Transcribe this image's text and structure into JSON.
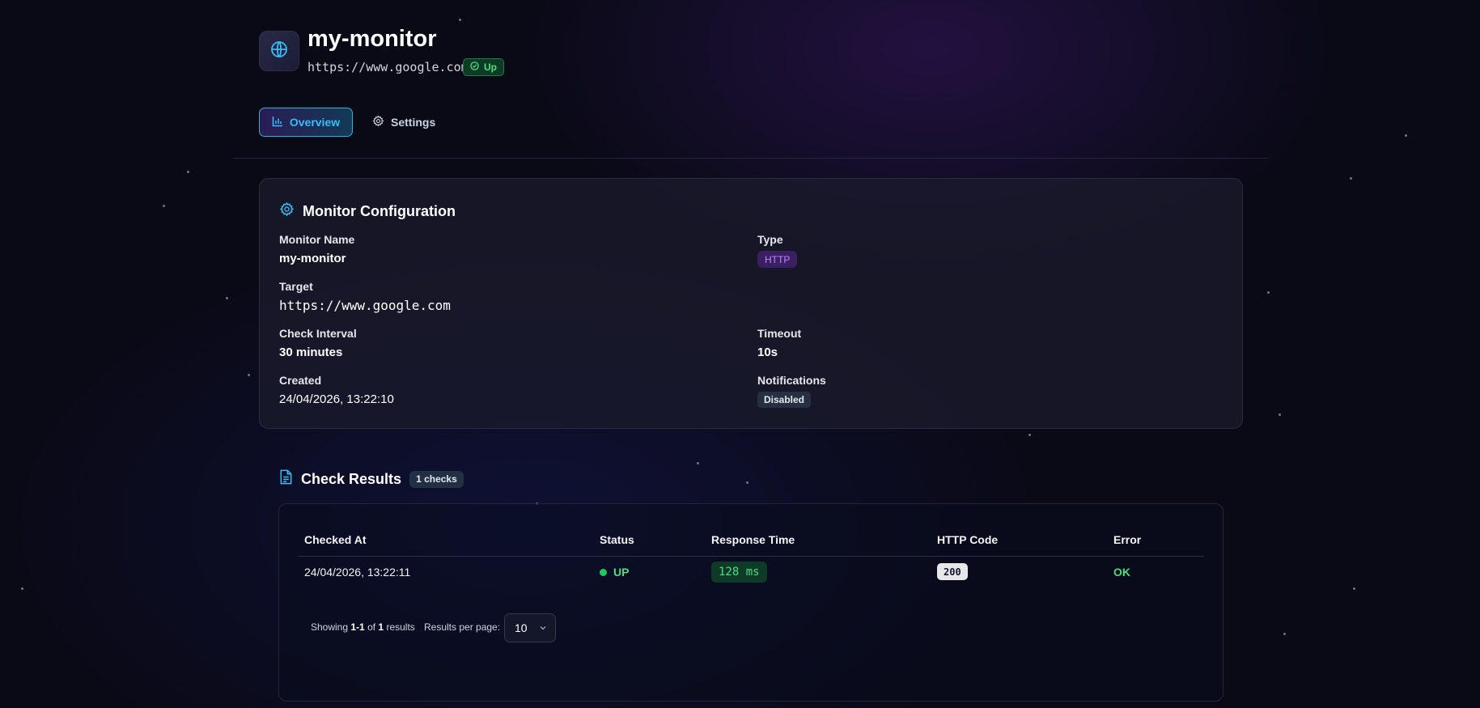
{
  "header": {
    "title": "my-monitor",
    "url": "https://www.google.com",
    "status_badge": "Up",
    "icon": "globe-icon"
  },
  "tabs": [
    {
      "label": "Overview",
      "icon": "bar-chart-icon",
      "active": true
    },
    {
      "label": "Settings",
      "icon": "gear-icon",
      "active": false
    }
  ],
  "config": {
    "title": "Monitor Configuration",
    "name_label": "Monitor Name",
    "name_value": "my-monitor",
    "type_label": "Type",
    "type_value": "HTTP",
    "target_label": "Target",
    "target_value": "https://www.google.com",
    "interval_label": "Check Interval",
    "interval_value": "30 minutes",
    "timeout_label": "Timeout",
    "timeout_value": "10s",
    "created_label": "Created",
    "created_value": "24/04/2026, 13:22:10",
    "notifications_label": "Notifications",
    "notifications_value": "Disabled"
  },
  "results": {
    "title": "Check Results",
    "count_badge": "1 checks",
    "columns": [
      "Checked At",
      "Status",
      "Response Time",
      "HTTP Code",
      "Error"
    ],
    "rows": [
      {
        "checked_at": "24/04/2026, 13:22:11",
        "status": "UP",
        "response_time": "128 ms",
        "http_code": "200",
        "error": "OK"
      }
    ],
    "pagination": {
      "showing_prefix": "Showing",
      "range": "1-1",
      "of": "of",
      "total": "1",
      "suffix": "results",
      "per_page_label": "Results per page:",
      "per_page_value": "10"
    }
  },
  "colors": {
    "accent": "#22b8d6",
    "success": "#4ade80",
    "background": "#0a0a17"
  }
}
